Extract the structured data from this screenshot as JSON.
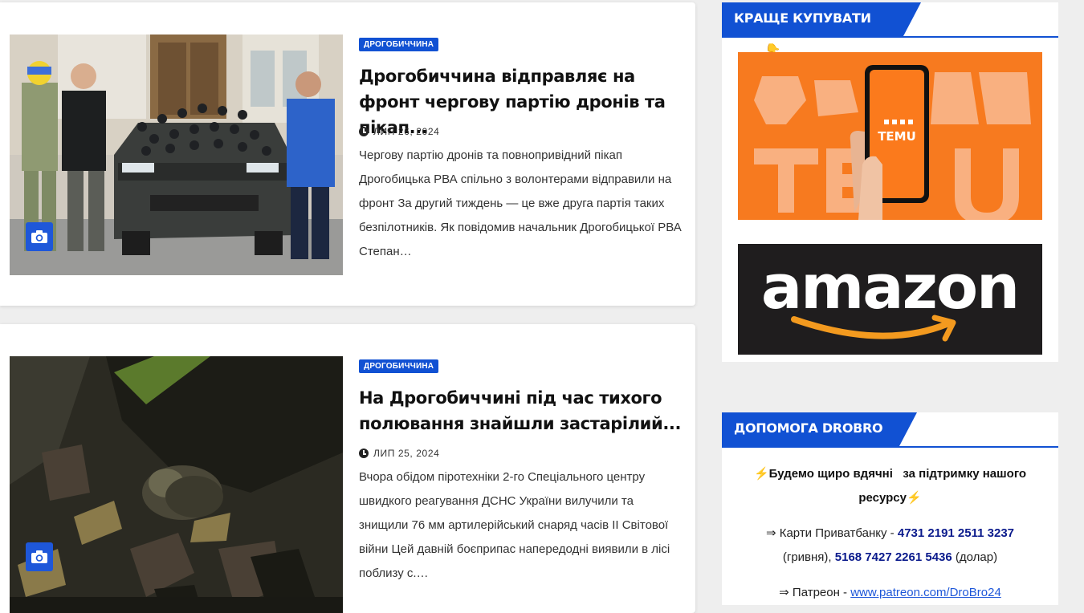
{
  "posts": [
    {
      "category": "ДРОГОБИЧЧИНА",
      "title": "Дрогобиччина відправляє на фронт чергову партію дронів та пікап...",
      "date": "ЛИП 26, 2024",
      "excerpt": "Чергову партію дронів та повнопривідний пікап Дрогобицька РВА спільно з волонтерами відправили на фронт За другий тиждень — це вже друга партія таких безпілотників. Як повідомив начальник Дрогобицької РВА Степан…",
      "media_icon": "camera-icon"
    },
    {
      "category": "ДРОГОБИЧЧИНА",
      "title": "На Дрогобиччині під час тихого полювання знайшли застарілий...",
      "date": "ЛИП 25, 2024",
      "excerpt": "Вчора обідом піротехніки 2-го Спеціального центру швидкого реагування ДСНС України вилучили та знищили 76 мм артилерійський снаряд часів ІІ Світової війни Цей давній боєприпас напередодні виявили в лісі поблизу с.…",
      "media_icon": "camera-icon"
    }
  ],
  "sidebar": {
    "shop_widget": {
      "title": "КРАЩЕ КУПУВАТИ ТУТ 👇",
      "temu_label": "TEMU",
      "amazon_label": "amazon"
    },
    "help_widget": {
      "title": "ДОПОМОГА DROBRO",
      "thanks_emoji": "⚡",
      "thanks_text": "Будемо щиро вдячні   за підтримку нашого ресурсу",
      "cards_prefix": "⇒ Карти Приватбанку - ",
      "card_uah": "4731 2191 2511 3237",
      "uah_label": " (гривня), ",
      "card_usd": "5168 7427 2261 5436",
      "usd_label": " (долар)",
      "patreon_prefix": "⇒ Патреон - ",
      "patreon_link": "www.patreon.com/DroBro24"
    }
  },
  "colors": {
    "accent": "#1151d3",
    "card_number": "#0a1a8c",
    "temu_orange": "#f77a1f",
    "amazon_arrow": "#f39a1f"
  }
}
